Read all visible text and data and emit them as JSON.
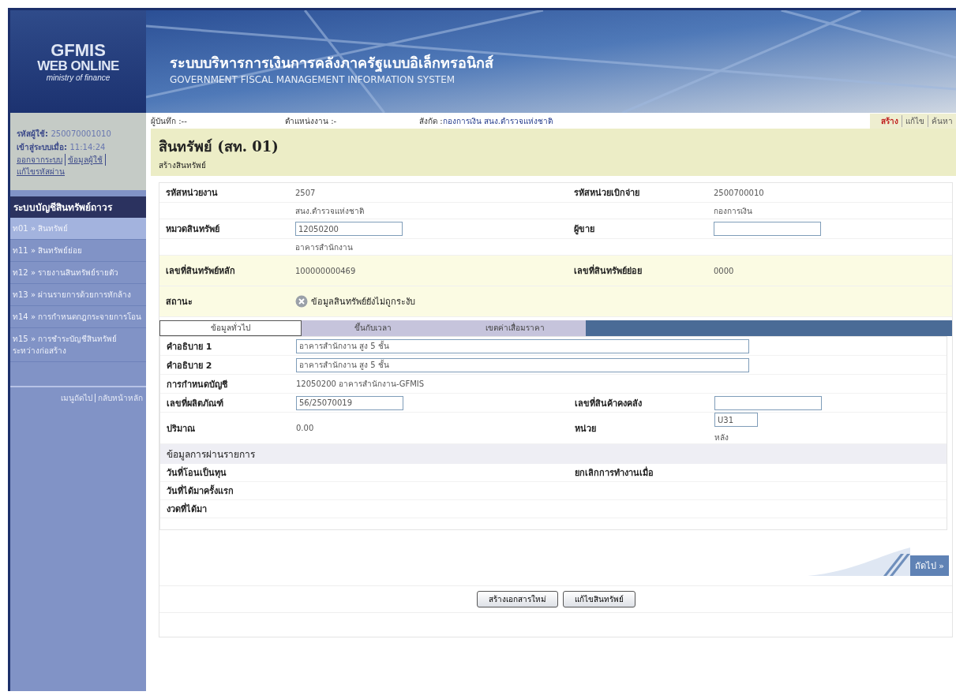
{
  "header": {
    "logo_lines": [
      "GFMIS",
      "WEB ONLINE",
      "ministry of finance"
    ],
    "title_th": "ระบบบริหารการเงินการคลังภาครัฐแบบอิเล็กทรอนิกส์",
    "title_en": "GOVERNMENT FISCAL MANAGEMENT INFORMATION SYSTEM"
  },
  "user_panel": {
    "user_id_label": "รหัสผู้ใช้:",
    "user_id": "250070001010",
    "login_label": "เข้าสู่ระบบเมื่อ:",
    "login_time": "11:14:24",
    "links": [
      "ออกจากระบบ",
      "ข้อมูลผู้ใช้",
      "แก้ไขรหัสผ่าน"
    ]
  },
  "sidebar": {
    "section_title": "ระบบบัญชีสินทรัพย์ถาวร",
    "items": [
      {
        "label": "ท01 » สินทรัพย์",
        "selected": true
      },
      {
        "label": "ท11 » สินทรัพย์ย่อย",
        "selected": false
      },
      {
        "label": "ท12 » รายงานสินทรัพย์รายตัว",
        "selected": false
      },
      {
        "label": "ท13 » ผ่านรายการด้วยการหักล้าง",
        "selected": false
      },
      {
        "label": "ท14 » การกำหนดกฎกระจายการโอน",
        "selected": false
      },
      {
        "label": "ท15 » การชำระบัญชีสินทรัพย์ระหว่างก่อสร้าง",
        "selected": false
      }
    ],
    "footer_links": [
      "เมนูถัดไป",
      "กลับหน้าหลัก"
    ]
  },
  "info_bar": {
    "fields": [
      {
        "label": "ผู้บันทึก :",
        "value": "--"
      },
      {
        "label": "ตำแหน่งงาน :",
        "value": "-"
      },
      {
        "label": "สังกัด :",
        "value": "กองการเงิน สนง.ตำรวจแห่งชาติ"
      }
    ],
    "actions": [
      {
        "label": "สร้าง",
        "selected": true
      },
      {
        "label": "แก้ไข",
        "selected": false
      },
      {
        "label": "ค้นหา",
        "selected": false
      }
    ]
  },
  "page_title": "สินทรัพย์ (สท. 01)",
  "page_subtitle": "สร้างสินทรัพย์",
  "general_rows": [
    {
      "left": {
        "label": "รหัสหน่วยงาน",
        "kind": "text",
        "value": "2507",
        "note": "สนง.ตำรวจแห่งชาติ"
      },
      "right": {
        "label": "รหัสหน่วยเบิกจ่าย",
        "kind": "text",
        "value": "2500700010",
        "note": "กองการเงิน"
      }
    },
    {
      "left": {
        "label": "หมวดสินทรัพย์",
        "kind": "input",
        "value": "12050200",
        "note": "อาคารสำนักงาน"
      },
      "right": {
        "label": "ผู้ขาย",
        "kind": "input"
      }
    }
  ],
  "asset_rows": [
    {
      "left": {
        "label": "เลขที่สินทรัพย์หลัก",
        "kind": "text",
        "value": "100000000469"
      },
      "right": {
        "label": "เลขที่สินทรัพย์ย่อย",
        "kind": "text",
        "value": "0000"
      }
    },
    {
      "left": {
        "label": "สถานะ",
        "kind": "status",
        "value": "ข้อมูลสินทรัพย์ยังไม่ถูกระงับ"
      }
    }
  ],
  "tabs": [
    {
      "label": "ข้อมูลทั่วไป",
      "selected": true
    },
    {
      "label": "ขึ้นกับเวลา",
      "selected": false
    },
    {
      "label": "เขตค่าเสื่อมราคา",
      "selected": false
    }
  ],
  "tab_rows": [
    {
      "left": {
        "label": "คำอธิบาย 1",
        "kind": "wide_input",
        "value": "อาคารสำนักงาน สูง 5 ชั้น"
      }
    },
    {
      "left": {
        "label": "คำอธิบาย 2",
        "kind": "wide_input",
        "value": "อาคารสำนักงาน สูง 5 ชั้น"
      }
    },
    {
      "left": {
        "label": "การกำหนดบัญชี",
        "kind": "text",
        "value": "12050200 อาคารสำนักงาน-GFMIS"
      }
    },
    {
      "left": {
        "label": "เลขที่ผลิตภัณฑ์",
        "kind": "input",
        "value": "56/25070019"
      },
      "right": {
        "label": "เลขที่สินค้าคงคลัง",
        "kind": "input"
      }
    },
    {
      "left": {
        "label": "ปริมาณ",
        "kind": "text",
        "value": "0.00"
      },
      "right": {
        "label": "หน่วย",
        "kind": "short_input",
        "value": "U31",
        "note": "หลัง"
      }
    }
  ],
  "posting_section": {
    "title": "ข้อมูลการผ่านรายการ",
    "rows": [
      {
        "left": {
          "label": "วันที่โอนเป็นทุน"
        },
        "right": {
          "label": "ยกเลิกการทำงานเมื่อ"
        }
      },
      {
        "left": {
          "label": "วันที่ได้มาครั้งแรก"
        }
      },
      {
        "left": {
          "label": "งวดที่ได้มา"
        }
      }
    ]
  },
  "next_button": "ถัดไป »",
  "buttons": [
    "สร้างเอกสารใหม่",
    "แก้ไขสินทรัพย์"
  ]
}
